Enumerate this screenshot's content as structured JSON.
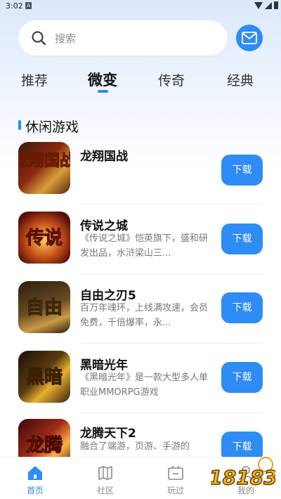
{
  "status_bar": {
    "time": "3:02",
    "notif": "A"
  },
  "search": {
    "placeholder": "搜索"
  },
  "tabs": [
    {
      "label": "推荐",
      "active": false
    },
    {
      "label": "微变",
      "active": true
    },
    {
      "label": "传奇",
      "active": false
    },
    {
      "label": "经典",
      "active": false
    }
  ],
  "section": {
    "title": "休闲游戏"
  },
  "games": [
    {
      "name": "龙翔国战",
      "desc": "",
      "button": "下载",
      "icon_text": "龙翔国战"
    },
    {
      "name": "传说之城",
      "desc": "《传说之城》恺英旗下，盛和研发出品，水浒梁山三...",
      "button": "下载",
      "icon_text": "传说"
    },
    {
      "name": "自由之刃5",
      "desc": "百万年魂环，上线满攻速，会员免费，千倍爆率，永...",
      "button": "下载",
      "icon_text": "自由"
    },
    {
      "name": "黑暗光年",
      "desc": "《黑暗光年》是一款大型多人单职业MMORPG游戏",
      "button": "下载",
      "icon_text": "黑暗"
    },
    {
      "name": "龙腾天下2",
      "desc": "融合了端游，页游、手游的",
      "button": "下载",
      "icon_text": "龙腾"
    }
  ],
  "nav": [
    {
      "label": "首页",
      "icon": "home-icon",
      "active": true
    },
    {
      "label": "社区",
      "icon": "map-icon",
      "active": false
    },
    {
      "label": "玩过",
      "icon": "box-icon",
      "active": false
    },
    {
      "label": "我的",
      "icon": "user-icon",
      "active": false
    }
  ],
  "watermark": {
    "text": "18183"
  },
  "colors": {
    "accent": "#2d8cf5",
    "text": "#111111",
    "muted": "#777777"
  }
}
